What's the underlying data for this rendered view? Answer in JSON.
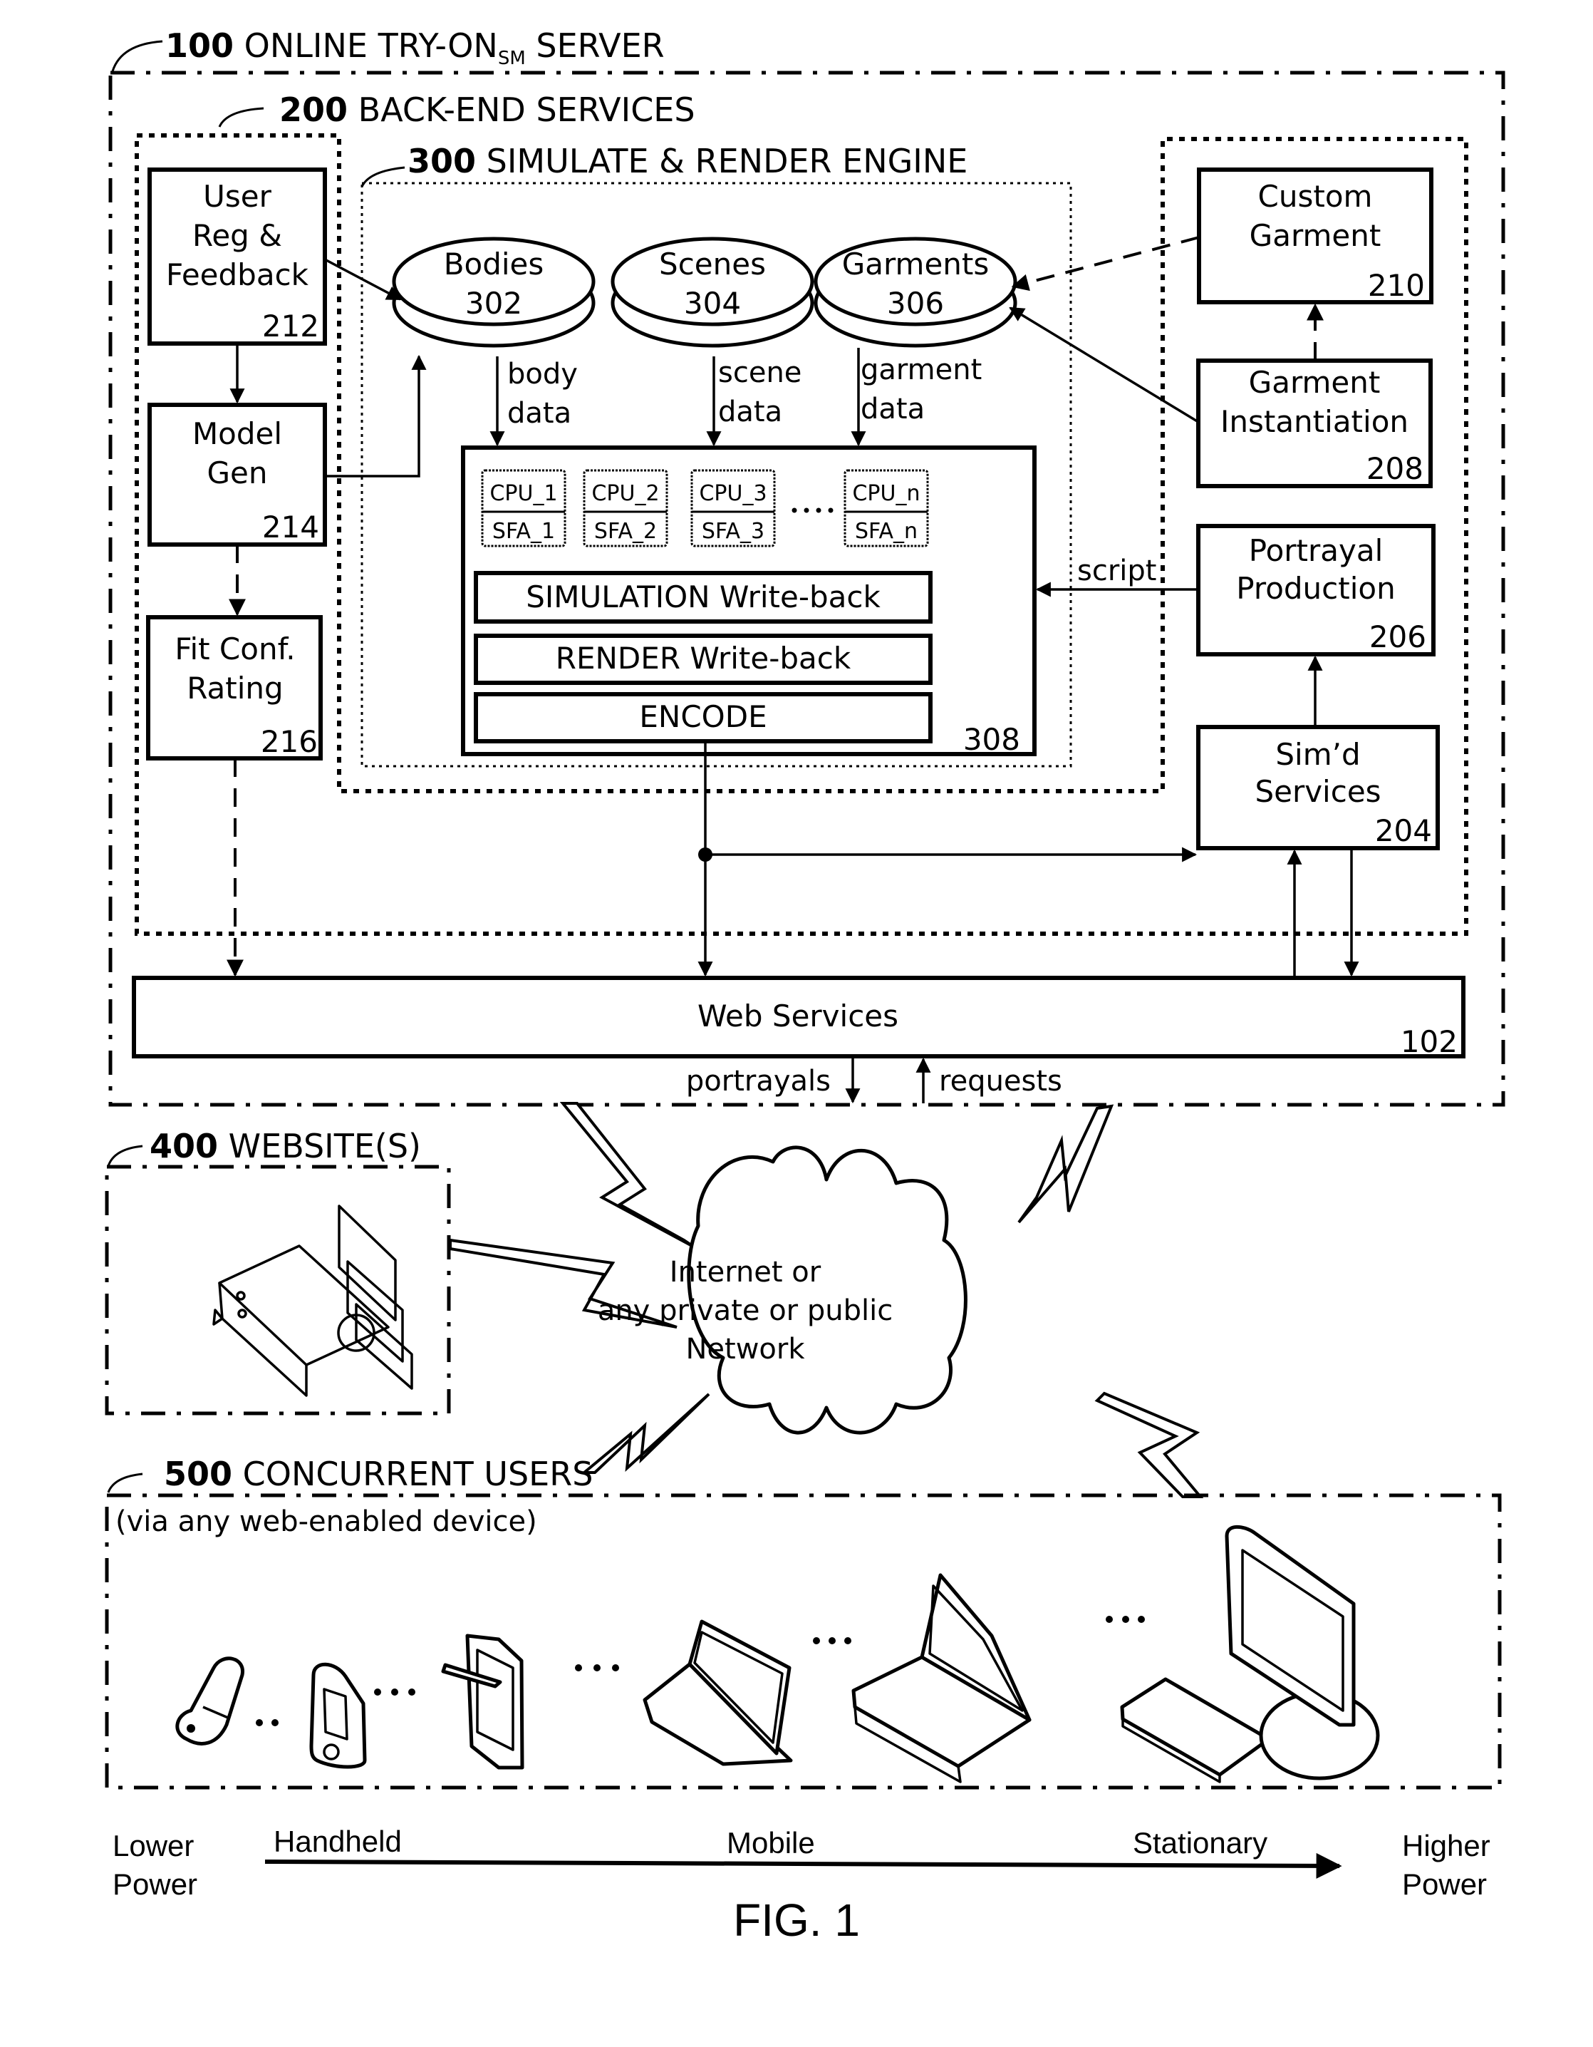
{
  "figure": {
    "caption": "FIG. 1"
  },
  "server": {
    "ref": "100",
    "title_main": "ONLINE TRY-ON",
    "title_sub": "SM",
    "title_tail": "SERVER",
    "web_services": {
      "label": "Web Services",
      "ref": "102"
    },
    "flows": {
      "out": "portrayals",
      "in": "requests"
    }
  },
  "backend": {
    "ref": "200",
    "title": "BACK-END SERVICES",
    "left_boxes": [
      {
        "id": "user-reg",
        "lines": [
          "User",
          "Reg &",
          "Feedback"
        ],
        "ref": "212"
      },
      {
        "id": "model-gen",
        "lines": [
          "Model",
          "Gen"
        ],
        "ref": "214"
      },
      {
        "id": "fit-conf",
        "lines": [
          "Fit Conf.",
          "Rating"
        ],
        "ref": "216"
      }
    ],
    "right_boxes": [
      {
        "id": "custom-garment",
        "lines": [
          "Custom",
          "Garment"
        ],
        "ref": "210"
      },
      {
        "id": "garment-instantiation",
        "lines": [
          "Garment",
          "Instantiation"
        ],
        "ref": "208"
      },
      {
        "id": "portrayal-production",
        "lines": [
          "Portrayal",
          "Production"
        ],
        "ref": "206"
      },
      {
        "id": "simd-services",
        "lines": [
          "Sim’d",
          "Services"
        ],
        "ref": "204"
      }
    ],
    "script_label": "script"
  },
  "engine": {
    "ref": "300",
    "title": "SIMULATE & RENDER ENGINE",
    "databases": [
      {
        "name": "Bodies",
        "ref": "302",
        "flow": [
          "body",
          "data"
        ]
      },
      {
        "name": "Scenes",
        "ref": "304",
        "flow": [
          "scene",
          "data"
        ]
      },
      {
        "name": "Garments",
        "ref": "306",
        "flow": [
          "garment",
          "data"
        ]
      }
    ],
    "processor": {
      "ref": "308",
      "units": [
        {
          "cpu": "CPU_1",
          "sfa": "SFA_1"
        },
        {
          "cpu": "CPU_2",
          "sfa": "SFA_2"
        },
        {
          "cpu": "CPU_3",
          "sfa": "SFA_3"
        },
        {
          "cpu": "CPU_n",
          "sfa": "SFA_n"
        }
      ],
      "stages": [
        "SIMULATION Write-back",
        "RENDER Write-back",
        "ENCODE"
      ]
    }
  },
  "websites": {
    "ref": "400",
    "title": "WEBSITE(S)",
    "icon": "web-server-icon"
  },
  "network": {
    "lines": [
      "Internet or",
      "any private or public",
      "Network"
    ],
    "icon": "cloud-icon"
  },
  "users": {
    "ref": "500",
    "title": "CONCURRENT USERS",
    "subtitle": "(via any web-enabled device)",
    "devices": [
      "flip-phone-icon",
      "pda-icon",
      "tablet-icon",
      "small-laptop-icon",
      "laptop-icon",
      "desktop-icon"
    ]
  },
  "power_axis": {
    "left": [
      "Lower",
      "Power"
    ],
    "right": [
      "Higher",
      "Power"
    ],
    "categories": [
      "Handheld",
      "Mobile",
      "Stationary"
    ]
  }
}
